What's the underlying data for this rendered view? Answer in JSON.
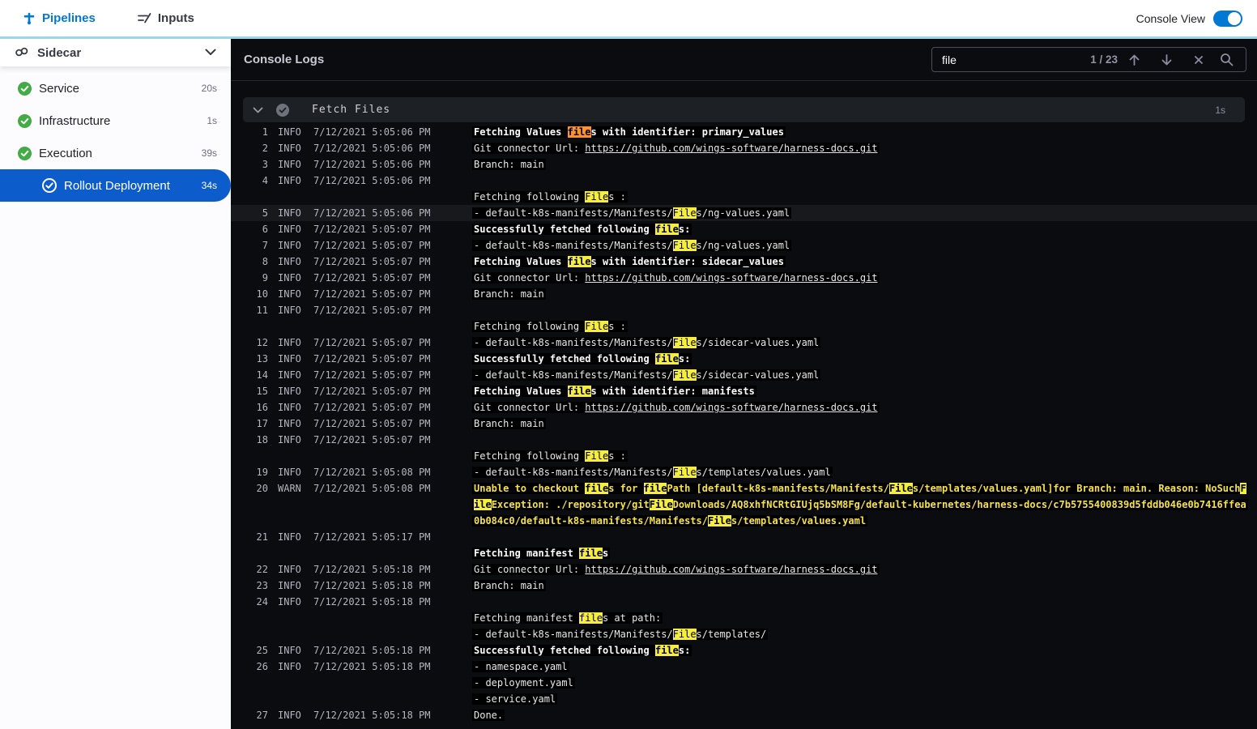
{
  "colors": {
    "blue": "#0278d5",
    "lightblue": "#96d7f3",
    "selblue": "#0d5ccc",
    "green": "#42ab45",
    "hl": "#f5ee3e",
    "cur": "#fb9230",
    "warn": "#f5e14a"
  },
  "header": {
    "tabs": [
      {
        "label": "Pipelines"
      },
      {
        "label": "Inputs"
      }
    ],
    "console_view_label": "Console View"
  },
  "sidebar": {
    "title": "Sidecar",
    "items": [
      {
        "label": "Service",
        "duration": "20s"
      },
      {
        "label": "Infrastructure",
        "duration": "1s"
      },
      {
        "label": "Execution",
        "duration": "39s"
      },
      {
        "label": "Rollout Deployment",
        "duration": "34s"
      }
    ]
  },
  "console": {
    "title": "Console Logs",
    "search": {
      "value": "file",
      "count": "1 / 23"
    },
    "section": {
      "title": "Fetch Files",
      "duration": "1s"
    },
    "logs": [
      {
        "n": "1",
        "level": "INFO",
        "time": "7/12/2021 5:05:06 PM",
        "lines": [
          {
            "b": 1,
            "seg": [
              {
                "t": "Fetching Values "
              },
              {
                "t": "file",
                "m": "cur"
              },
              {
                "t": "s with identifier: primary_values"
              }
            ]
          }
        ]
      },
      {
        "n": "2",
        "level": "INFO",
        "time": "7/12/2021 5:05:06 PM",
        "lines": [
          {
            "seg": [
              {
                "t": "Git connector Url: "
              },
              {
                "t": "https://github.com/wings-software/harness-docs.git",
                "u": 1
              }
            ]
          }
        ]
      },
      {
        "n": "3",
        "level": "INFO",
        "time": "7/12/2021 5:05:06 PM",
        "lines": [
          {
            "seg": [
              {
                "t": "Branch: main"
              }
            ]
          }
        ]
      },
      {
        "n": "4",
        "level": "INFO",
        "time": "7/12/2021 5:05:06 PM",
        "lines": [
          {
            "seg": []
          },
          {
            "seg": [
              {
                "t": "Fetching following "
              },
              {
                "t": "File",
                "m": "hl"
              },
              {
                "t": "s :"
              }
            ]
          }
        ]
      },
      {
        "n": "5",
        "level": "INFO",
        "time": "7/12/2021 5:05:06 PM",
        "sel": 1,
        "lines": [
          {
            "seg": [
              {
                "t": "- default-k8s-manifests/Manifests/"
              },
              {
                "t": "File",
                "m": "hl"
              },
              {
                "t": "s/ng-values.yaml"
              }
            ]
          }
        ]
      },
      {
        "n": "6",
        "level": "INFO",
        "time": "7/12/2021 5:05:07 PM",
        "lines": [
          {
            "b": 1,
            "seg": [
              {
                "t": "Successfully fetched following "
              },
              {
                "t": "file",
                "m": "hl"
              },
              {
                "t": "s:"
              }
            ]
          }
        ]
      },
      {
        "n": "7",
        "level": "INFO",
        "time": "7/12/2021 5:05:07 PM",
        "lines": [
          {
            "seg": [
              {
                "t": "- default-k8s-manifests/Manifests/"
              },
              {
                "t": "File",
                "m": "hl"
              },
              {
                "t": "s/ng-values.yaml"
              }
            ]
          }
        ]
      },
      {
        "n": "8",
        "level": "INFO",
        "time": "7/12/2021 5:05:07 PM",
        "lines": [
          {
            "b": 1,
            "seg": [
              {
                "t": "Fetching Values "
              },
              {
                "t": "file",
                "m": "hl"
              },
              {
                "t": "s with identifier: sidecar_values"
              }
            ]
          }
        ]
      },
      {
        "n": "9",
        "level": "INFO",
        "time": "7/12/2021 5:05:07 PM",
        "lines": [
          {
            "seg": [
              {
                "t": "Git connector Url: "
              },
              {
                "t": "https://github.com/wings-software/harness-docs.git",
                "u": 1
              }
            ]
          }
        ]
      },
      {
        "n": "10",
        "level": "INFO",
        "time": "7/12/2021 5:05:07 PM",
        "lines": [
          {
            "seg": [
              {
                "t": "Branch: main"
              }
            ]
          }
        ]
      },
      {
        "n": "11",
        "level": "INFO",
        "time": "7/12/2021 5:05:07 PM",
        "lines": [
          {
            "seg": []
          },
          {
            "seg": [
              {
                "t": "Fetching following "
              },
              {
                "t": "File",
                "m": "hl"
              },
              {
                "t": "s :"
              }
            ]
          }
        ]
      },
      {
        "n": "12",
        "level": "INFO",
        "time": "7/12/2021 5:05:07 PM",
        "lines": [
          {
            "seg": [
              {
                "t": "- default-k8s-manifests/Manifests/"
              },
              {
                "t": "File",
                "m": "hl"
              },
              {
                "t": "s/sidecar-values.yaml"
              }
            ]
          }
        ]
      },
      {
        "n": "13",
        "level": "INFO",
        "time": "7/12/2021 5:05:07 PM",
        "lines": [
          {
            "b": 1,
            "seg": [
              {
                "t": "Successfully fetched following "
              },
              {
                "t": "file",
                "m": "hl"
              },
              {
                "t": "s:"
              }
            ]
          }
        ]
      },
      {
        "n": "14",
        "level": "INFO",
        "time": "7/12/2021 5:05:07 PM",
        "lines": [
          {
            "seg": [
              {
                "t": "- default-k8s-manifests/Manifests/"
              },
              {
                "t": "File",
                "m": "hl"
              },
              {
                "t": "s/sidecar-values.yaml"
              }
            ]
          }
        ]
      },
      {
        "n": "15",
        "level": "INFO",
        "time": "7/12/2021 5:05:07 PM",
        "lines": [
          {
            "b": 1,
            "seg": [
              {
                "t": "Fetching Values "
              },
              {
                "t": "file",
                "m": "hl"
              },
              {
                "t": "s with identifier: manifests"
              }
            ]
          }
        ]
      },
      {
        "n": "16",
        "level": "INFO",
        "time": "7/12/2021 5:05:07 PM",
        "lines": [
          {
            "seg": [
              {
                "t": "Git connector Url: "
              },
              {
                "t": "https://github.com/wings-software/harness-docs.git",
                "u": 1
              }
            ]
          }
        ]
      },
      {
        "n": "17",
        "level": "INFO",
        "time": "7/12/2021 5:05:07 PM",
        "lines": [
          {
            "seg": [
              {
                "t": "Branch: main"
              }
            ]
          }
        ]
      },
      {
        "n": "18",
        "level": "INFO",
        "time": "7/12/2021 5:05:07 PM",
        "lines": [
          {
            "seg": []
          },
          {
            "seg": [
              {
                "t": "Fetching following "
              },
              {
                "t": "File",
                "m": "hl"
              },
              {
                "t": "s :"
              }
            ]
          }
        ]
      },
      {
        "n": "19",
        "level": "INFO",
        "time": "7/12/2021 5:05:08 PM",
        "lines": [
          {
            "seg": [
              {
                "t": "- default-k8s-manifests/Manifests/"
              },
              {
                "t": "File",
                "m": "hl"
              },
              {
                "t": "s/templates/values.yaml"
              }
            ]
          }
        ]
      },
      {
        "n": "20",
        "level": "WARN",
        "time": "7/12/2021 5:05:08 PM",
        "wrap": 3,
        "lines": [
          {
            "w": 1,
            "seg": [
              {
                "t": "Unable to checkout "
              },
              {
                "t": "file",
                "m": "hl"
              },
              {
                "t": "s for "
              },
              {
                "t": "file",
                "m": "hl"
              },
              {
                "t": "Path [default-k8s-manifests/Manifests/"
              },
              {
                "t": "File",
                "m": "hl"
              },
              {
                "t": "s/templates/values.yaml]for Branch: main. Reason: NoSuch"
              },
              {
                "t": "File",
                "m": "hl"
              },
              {
                "t": "Exception: ./repository/git"
              },
              {
                "t": "File",
                "m": "hl"
              },
              {
                "t": "Downloads/AQ8xhfNCRtGIUjq5bSM8Fg/default-kubernetes/harness-docs/c7b5755400839d5fddb046e0b7416ffea0b084c0/default-k8s-manifests/Manifests/"
              },
              {
                "t": "File",
                "m": "hl"
              },
              {
                "t": "s/templates/values.yaml"
              }
            ]
          }
        ]
      },
      {
        "n": "21",
        "level": "INFO",
        "time": "7/12/2021 5:05:17 PM",
        "lines": [
          {
            "seg": []
          },
          {
            "b": 1,
            "seg": [
              {
                "t": "Fetching manifest "
              },
              {
                "t": "file",
                "m": "hl"
              },
              {
                "t": "s"
              }
            ]
          }
        ]
      },
      {
        "n": "22",
        "level": "INFO",
        "time": "7/12/2021 5:05:18 PM",
        "lines": [
          {
            "seg": [
              {
                "t": "Git connector Url: "
              },
              {
                "t": "https://github.com/wings-software/harness-docs.git",
                "u": 1
              }
            ]
          }
        ]
      },
      {
        "n": "23",
        "level": "INFO",
        "time": "7/12/2021 5:05:18 PM",
        "lines": [
          {
            "seg": [
              {
                "t": "Branch: main"
              }
            ]
          }
        ]
      },
      {
        "n": "24",
        "level": "INFO",
        "time": "7/12/2021 5:05:18 PM",
        "lines": [
          {
            "seg": []
          },
          {
            "seg": [
              {
                "t": "Fetching manifest "
              },
              {
                "t": "file",
                "m": "hl"
              },
              {
                "t": "s at path:"
              }
            ]
          },
          {
            "seg": [
              {
                "t": "- default-k8s-manifests/Manifests/"
              },
              {
                "t": "File",
                "m": "hl"
              },
              {
                "t": "s/templates/"
              }
            ]
          }
        ]
      },
      {
        "n": "25",
        "level": "INFO",
        "time": "7/12/2021 5:05:18 PM",
        "lines": [
          {
            "b": 1,
            "seg": [
              {
                "t": "Successfully fetched following "
              },
              {
                "t": "file",
                "m": "hl"
              },
              {
                "t": "s:"
              }
            ]
          }
        ]
      },
      {
        "n": "26",
        "level": "INFO",
        "time": "7/12/2021 5:05:18 PM",
        "lines": [
          {
            "seg": [
              {
                "t": "- namespace.yaml"
              }
            ]
          },
          {
            "seg": [
              {
                "t": "- deployment.yaml"
              }
            ]
          },
          {
            "seg": [
              {
                "t": "- service.yaml"
              }
            ]
          }
        ]
      },
      {
        "n": "27",
        "level": "INFO",
        "time": "7/12/2021 5:05:18 PM",
        "lines": [
          {
            "seg": [
              {
                "t": "Done."
              }
            ]
          }
        ]
      }
    ]
  }
}
